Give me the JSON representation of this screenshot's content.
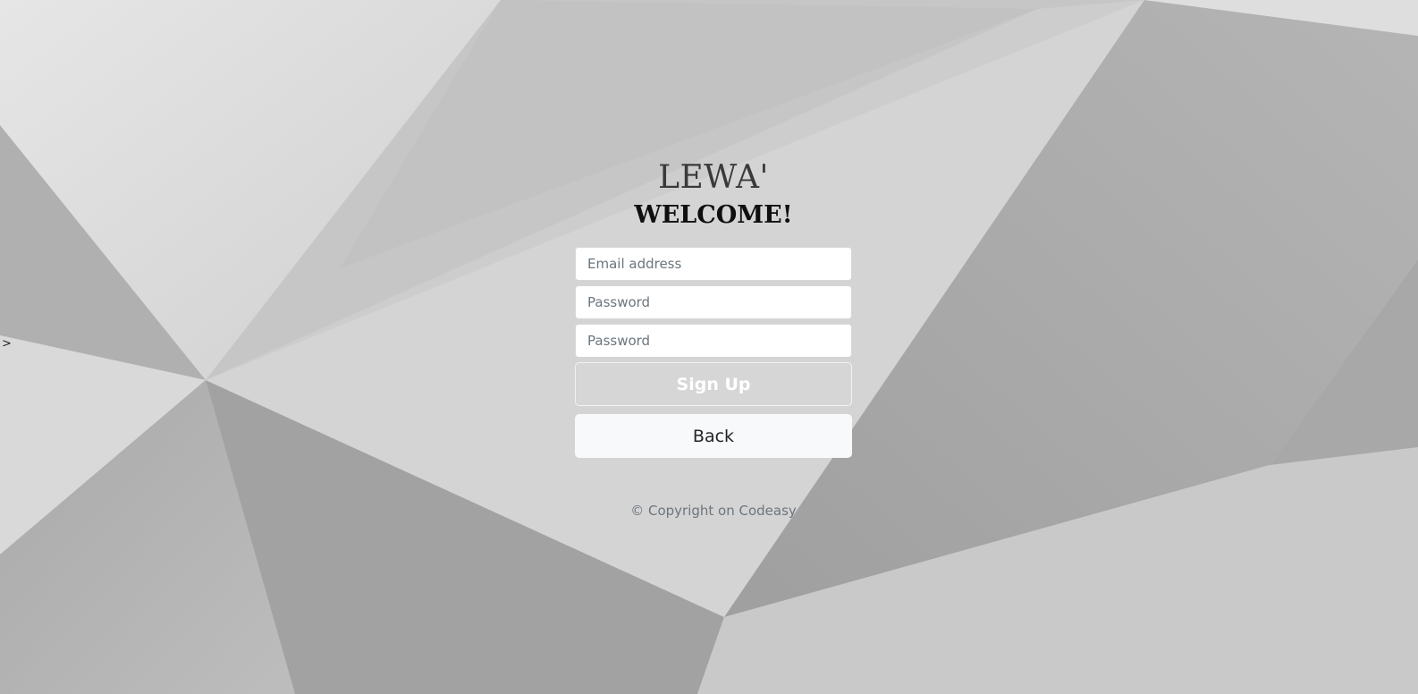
{
  "page": {
    "stray_mark": ">"
  },
  "form": {
    "brand": "LEWA'",
    "welcome": "WELCOME!",
    "email_placeholder": "Email address",
    "password_placeholder": "Password",
    "confirm_password_placeholder": "Password",
    "signup_label": "Sign Up",
    "back_label": "Back"
  },
  "footer": {
    "copyright": "© Copyright on Codeasy"
  },
  "colors": {
    "background": "#cfcfcf",
    "back_button": "#f8f9fa",
    "muted_text": "#6c757d"
  }
}
